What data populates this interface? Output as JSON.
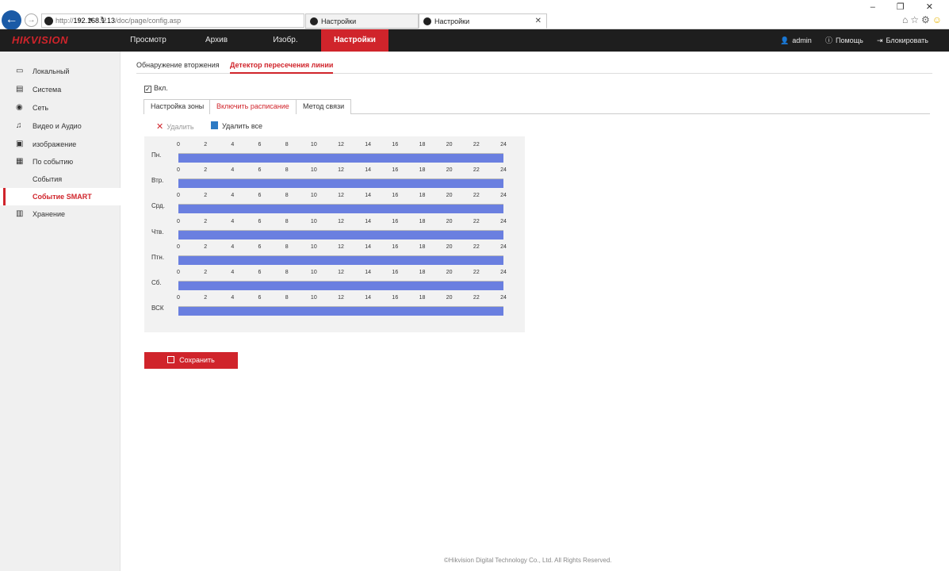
{
  "browser": {
    "url_prefix": "http://",
    "url_host": "192.168.1.13",
    "url_path": "/doc/page/config.asp",
    "address_tools": "⌕ ▾ ↻",
    "tabs": [
      {
        "label": "Настройки"
      },
      {
        "label": "Настройки"
      }
    ],
    "window_controls": "– ❐ ✕"
  },
  "app": {
    "logo": "HIKVISION",
    "nav": [
      "Просмотр",
      "Архив",
      "Изобр.",
      "Настройки"
    ],
    "active_nav": "Настройки",
    "user": "admin",
    "help": "Помощь",
    "lock": "Блокировать",
    "accent_color": "#d0242b"
  },
  "sidebar": {
    "items": [
      {
        "label": "Локальный",
        "icon": "monitor-icon"
      },
      {
        "label": "Система",
        "icon": "window-icon"
      },
      {
        "label": "Сеть",
        "icon": "globe-icon"
      },
      {
        "label": "Видео и Аудио",
        "icon": "mic-icon"
      },
      {
        "label": "изображение",
        "icon": "image-icon"
      },
      {
        "label": "По событию",
        "icon": "calendar-icon"
      },
      {
        "label": "События",
        "icon": ""
      },
      {
        "label": "Событие SMART",
        "icon": ""
      },
      {
        "label": "Хранение",
        "icon": "storage-icon"
      }
    ],
    "active": "Событие SMART"
  },
  "main": {
    "subtabs": [
      "Обнаружение вторжения",
      "Детектор пересечения линии"
    ],
    "active_subtab": "Детектор пересечения линии",
    "enable_label": "Вкл.",
    "enable_checked": true,
    "steps": [
      "Настройка зоны",
      "Включить расписание",
      "Метод связи"
    ],
    "active_step": "Включить расписание",
    "delete_label": "Удалить",
    "delete_all_label": "Удалить все",
    "schedule": {
      "ticks": [
        "0",
        "2",
        "4",
        "6",
        "8",
        "10",
        "12",
        "14",
        "16",
        "18",
        "20",
        "22",
        "24"
      ],
      "days": [
        "Пн.",
        "Втр.",
        "Срд.",
        "Чтв.",
        "Птн.",
        "Сб.",
        "ВСК"
      ],
      "coverage": [
        [
          0,
          24
        ],
        [
          0,
          24
        ],
        [
          0,
          24
        ],
        [
          0,
          24
        ],
        [
          0,
          24
        ],
        [
          0,
          24
        ],
        [
          0,
          24
        ]
      ],
      "bar_color": "#6a7fe0"
    },
    "save_label": "Сохранить"
  },
  "footer": "©Hikvision Digital Technology Co., Ltd. All Rights Reserved."
}
